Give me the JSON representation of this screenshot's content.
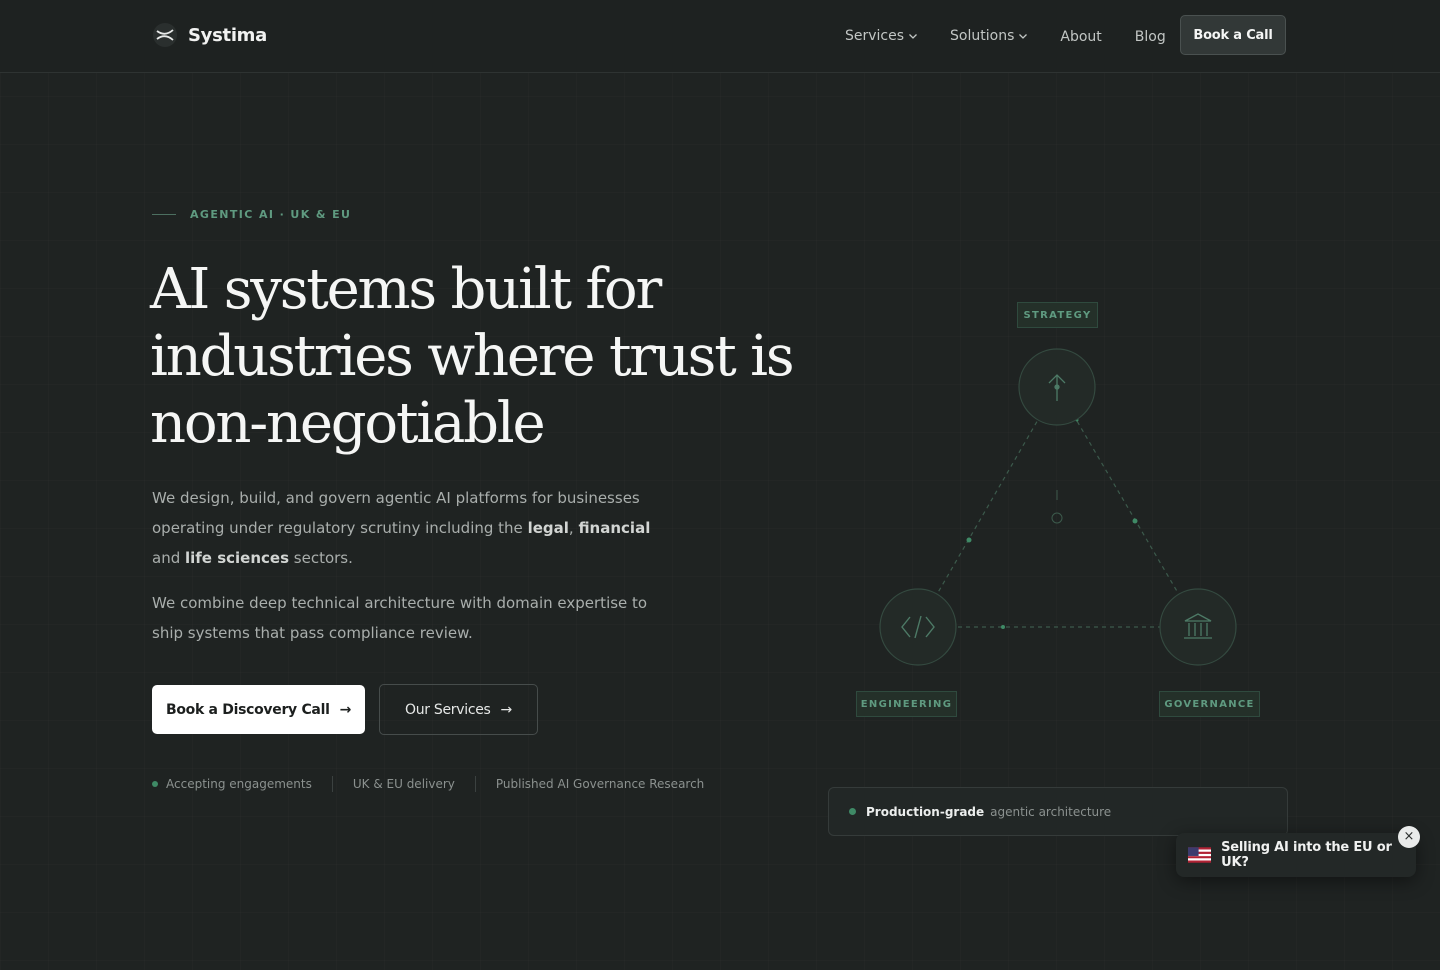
{
  "nav": {
    "brand": "Systima",
    "items": [
      {
        "label": "Services",
        "has_dropdown": true
      },
      {
        "label": "Solutions",
        "has_dropdown": true
      },
      {
        "label": "About",
        "has_dropdown": false
      },
      {
        "label": "Blog",
        "has_dropdown": false
      }
    ],
    "cta_label": "Book a Call"
  },
  "hero": {
    "eyebrow": "AGENTIC AI · UK & EU",
    "headline": "AI systems built for industries where trust is non-negotiable",
    "paragraph1": {
      "text_before": "We design, build, and govern agentic AI platforms for businesses operating under regulatory scrutiny including the ",
      "bold_1": "legal",
      "comma": ", ",
      "bold_2": "financial",
      "text_mid": " and ",
      "bold_3": "life sciences",
      "text_after": " sectors."
    },
    "paragraph2": "We combine deep technical architecture with domain expertise to ship systems that pass compliance review.",
    "primary_button": "Book a Discovery Call",
    "secondary_button": "Our Services",
    "arrow": "→",
    "status_items": [
      "Accepting engagements",
      "UK & EU delivery",
      "Published AI Governance Research"
    ]
  },
  "diagram": {
    "labels": {
      "top": "STRATEGY",
      "left": "ENGINEERING",
      "right": "GOVERNANCE"
    },
    "icons": {
      "top": "arrow-up-icon",
      "left": "code-icon",
      "right": "bank-icon"
    },
    "accent": "#3f8a66"
  },
  "status_card": {
    "strong": "Production-grade",
    "muted": "agentic architecture"
  },
  "toast": {
    "text": "Selling AI into the EU or UK?",
    "close": "×",
    "flag": "us-flag-icon"
  },
  "colors": {
    "background": "#1f2322",
    "accent": "#5f9a80",
    "primary_button_bg": "#ffffff"
  }
}
